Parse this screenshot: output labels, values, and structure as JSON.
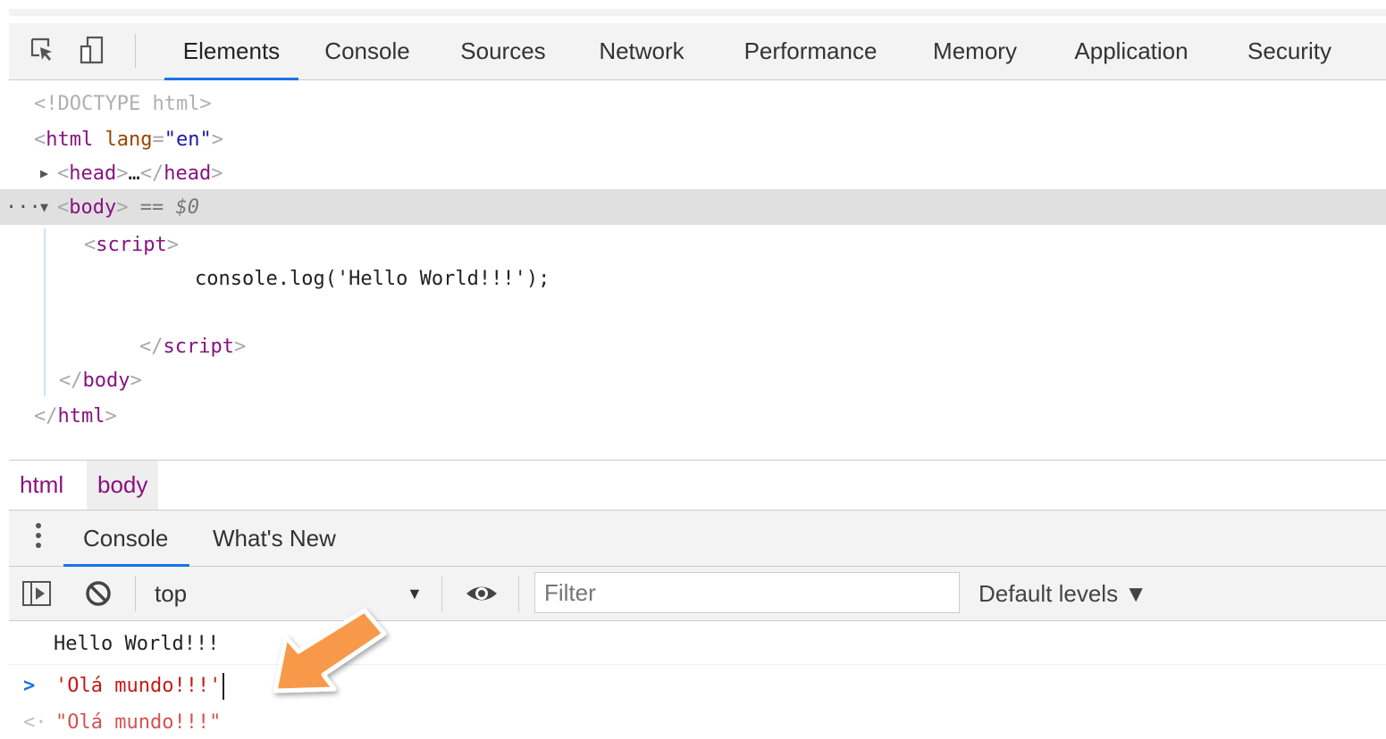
{
  "devtools": {
    "tabs": [
      "Elements",
      "Console",
      "Sources",
      "Network",
      "Performance",
      "Memory",
      "Application",
      "Security"
    ],
    "active_tab": "Elements",
    "tool_icons": [
      "inspect-element-icon",
      "device-toolbar-icon"
    ]
  },
  "elements_tree": {
    "doctype": "<!DOCTYPE html>",
    "html_open_tag": "html",
    "html_attr_name": "lang",
    "html_attr_value": "\"en\"",
    "head_collapsed": "head",
    "head_ellipsis": "…",
    "body_tag": "body",
    "selected_marker": "== $0",
    "script_open": "script",
    "script_content": "console.log('Hello World!!!');",
    "script_close": "script",
    "body_close": "body",
    "html_close": "html",
    "gutter_dots": "···"
  },
  "breadcrumb": [
    "html",
    "body"
  ],
  "drawer": {
    "tabs": [
      "Console",
      "What's New"
    ],
    "active_tab": "Console"
  },
  "console_toolbar": {
    "context": "top",
    "filter_placeholder": "Filter",
    "levels": "Default levels ▼"
  },
  "console_messages": {
    "log_output": "Hello World!!!",
    "input_expression": "'Olá mundo!!!'",
    "result": "\"Olá mundo!!!\""
  },
  "colors": {
    "accent": "#1a73e8",
    "tag": "#881280",
    "attr": "#994500",
    "attr_value": "#1a1aa6",
    "string": "#c41a16",
    "annotation_arrow": "#f7994a"
  }
}
